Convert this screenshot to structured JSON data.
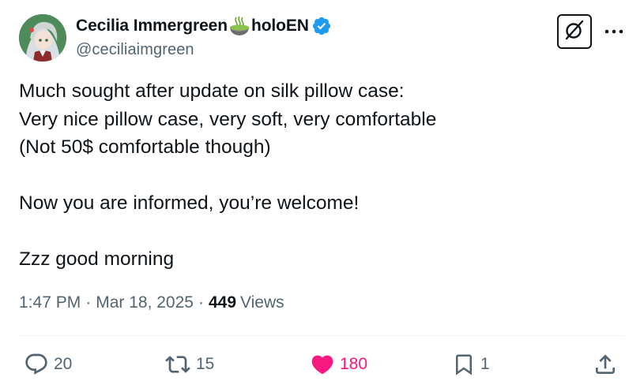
{
  "author": {
    "display_name_prefix": "Cecilia Immergreen",
    "display_name_emoji": "matcha-tea-emoji",
    "display_name_suffix": "holoEN",
    "handle": "@ceciliaimgreen",
    "verified": true,
    "verified_color": "#1d9bf0"
  },
  "tweet": {
    "lines": [
      "Much sought after update on silk pillow case:",
      "Very nice pillow case, very soft, very comfortable",
      "(Not 50$ comfortable though)",
      "",
      "Now you are informed, you’re welcome!",
      "",
      "Zzz good morning"
    ]
  },
  "meta": {
    "time": "1:47 PM",
    "separator": "·",
    "date": "Mar 18, 2025",
    "views_count": "449",
    "views_label": "Views"
  },
  "actions": {
    "reply_count": "20",
    "repost_count": "15",
    "like_count": "180",
    "bookmark_count": "1"
  },
  "colors": {
    "text": "#0f1419",
    "secondary": "#536471",
    "like": "#f91880",
    "divider": "#eff3f4"
  },
  "icons": {
    "grok": "grok-icon",
    "more": "more-dots-icon",
    "reply": "reply-bubble-icon",
    "repost": "repost-icon",
    "like": "heart-icon",
    "bookmark": "bookmark-icon",
    "share": "share-icon"
  }
}
